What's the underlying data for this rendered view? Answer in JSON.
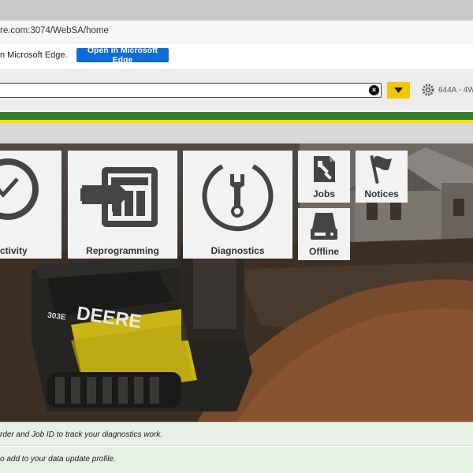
{
  "browser": {
    "url": "re.com:3074/WebSA/home",
    "infobar_text": "n Microsoft Edge.",
    "open_edge_label": "Open in Microsoft Edge"
  },
  "toolbar": {
    "search_value": "",
    "clear_icon": "×",
    "dropdown_icon": "caret-down-icon",
    "machine_label": "644A - 4W"
  },
  "brand_colors": {
    "green": "#367c2b",
    "yellow": "#ffde00",
    "dropdown": "#f2c600"
  },
  "tiles": {
    "activity": "ctivity",
    "reprogramming": "Reprogramming",
    "diagnostics": "Diagnostics",
    "jobs": "Jobs",
    "notices": "Notices",
    "offline": "Offline"
  },
  "hero": {
    "machine_brand": "DEERE",
    "machine_model": "303E"
  },
  "notifications": [
    {
      "text": "rder and Job ID to track your diagnostics work."
    },
    {
      "text": "o add to your data update profile."
    }
  ]
}
